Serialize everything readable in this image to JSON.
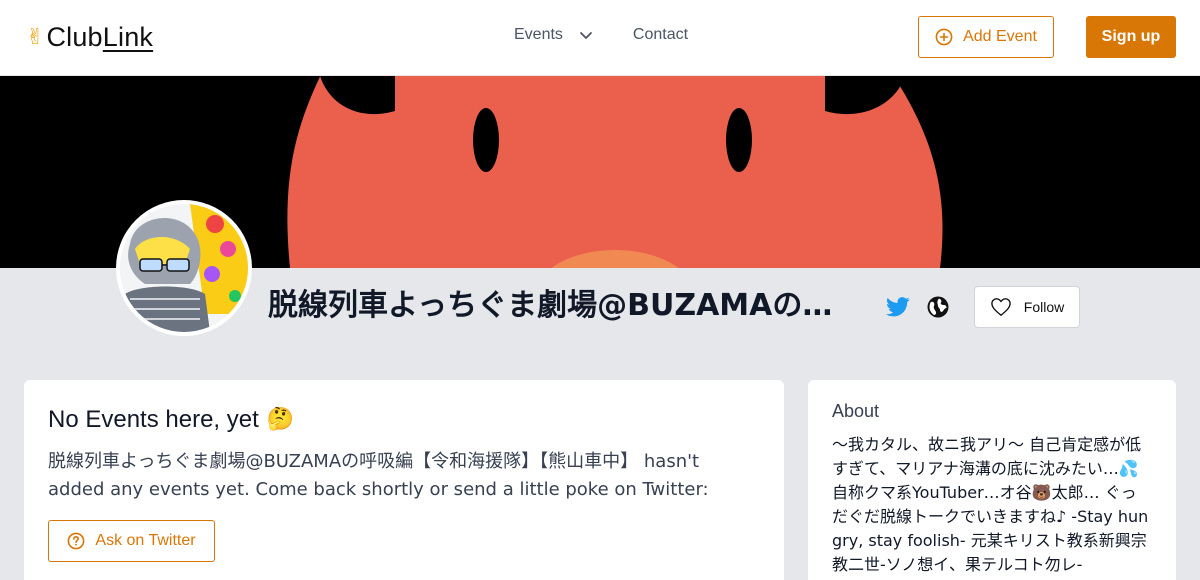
{
  "header": {
    "logo_hand": "✌",
    "logo_prefix": "Club",
    "logo_suffix": "Link",
    "nav": {
      "events_label": "Events",
      "contact_label": "Contact"
    },
    "add_event_label": "Add Event",
    "signup_label": "Sign up"
  },
  "profile": {
    "name": "脱線列車よっちぐま劇場@BUZAMAの呼吸編【令和海援隊】【熊山車中】",
    "follow_label": "Follow"
  },
  "main": {
    "title": "No Events here, yet",
    "title_emoji": "🤔",
    "message": "脱線列車よっちぐま劇場@BUZAMAの呼吸編【令和海援隊】【熊山車中】 hasn't added any events yet. Come back shortly or send a little poke on Twitter:",
    "ask_label": "Ask on Twitter"
  },
  "about": {
    "title": "About",
    "text": "〜我カタル、故ニ我アリ〜 自己肯定感が低すぎて、マリアナ海溝の底に沈みたい…💦自称クマ系YouTuber…オ谷🐻太郎… ぐっだぐだ脱線トークでいきますね♪ -Stay hungry, stay foolish- 元某キリスト教系新興宗教二世-ソノ想イ、果テルコト勿レ-"
  },
  "colors": {
    "accent": "#d97706",
    "banner_red": "#eb604c",
    "twitter_blue": "#1d9bf0"
  }
}
